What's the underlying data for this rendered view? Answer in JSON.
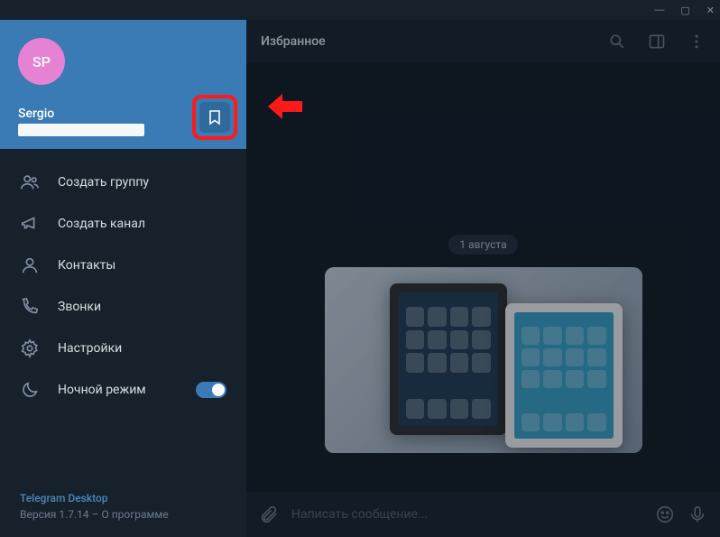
{
  "titlebar": {
    "min": "—",
    "max": "▢",
    "close": "✕"
  },
  "profile": {
    "initials": "SP",
    "name": "Sergio"
  },
  "menu": {
    "create_group": "Создать группу",
    "create_channel": "Создать канал",
    "contacts": "Контакты",
    "calls": "Звонки",
    "settings": "Настройки",
    "night_mode": "Ночной режим"
  },
  "footer": {
    "brand": "Telegram Desktop",
    "version": "Версия 1.7.14 – О программе"
  },
  "chat": {
    "title": "Избранное",
    "date": "1 августа",
    "placeholder": "Написать сообщение..."
  }
}
